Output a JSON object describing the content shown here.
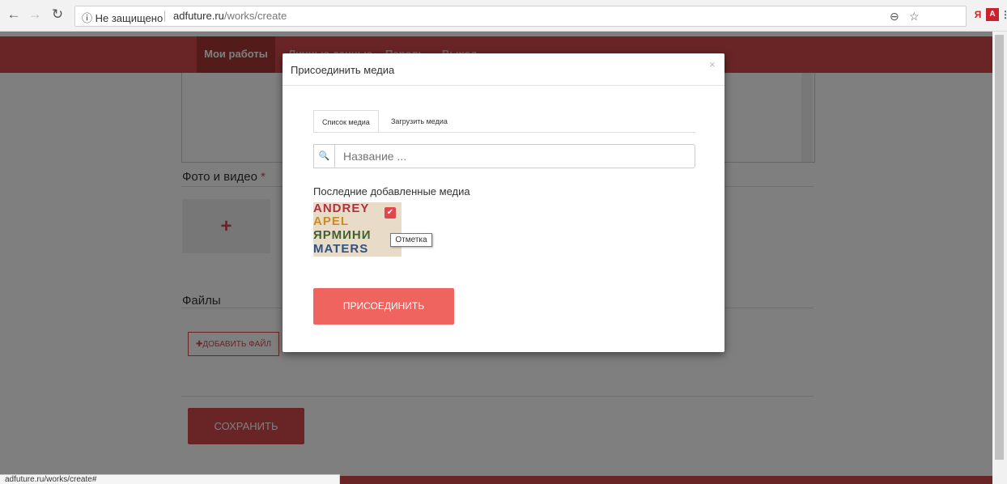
{
  "browser": {
    "security_label": "ⓘ Не защищено",
    "url_host": "adfuture.ru",
    "url_path": "/works/create",
    "status_url": "adfuture.ru/works/create#"
  },
  "nav": {
    "items": [
      "Мои работы",
      "Личные данные",
      "Пароль",
      "Выход"
    ]
  },
  "form": {
    "photo_label": "Фото и видео",
    "required_mark": "*",
    "add_media_symbol": "+",
    "files_label": "Файлы",
    "add_file_label": "✚ДОБАВИТЬ ФАЙЛ",
    "save_label": "СОХРАНИТЬ"
  },
  "modal": {
    "title": "Присоединить медиа",
    "close": "×",
    "tabs": [
      "Список медиа",
      "Загрузить медиа"
    ],
    "search_placeholder": "Название ...",
    "recent_label": "Последние добавленные медиа",
    "thumb_text": [
      "ANDREY",
      "APEL",
      "ЯРМИНИ",
      "MATERS"
    ],
    "tooltip": "Отметка",
    "attach_label": "ПРИСОЕДИНИТЬ"
  },
  "colors": {
    "accent": "#d24a4a",
    "button": "#f0645f"
  }
}
